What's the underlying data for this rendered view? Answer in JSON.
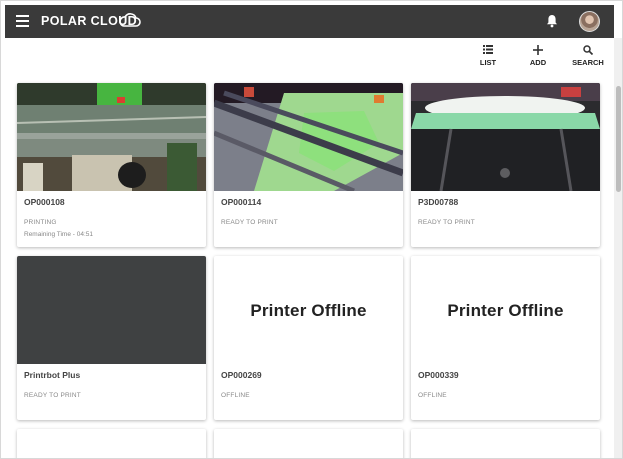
{
  "header": {
    "logo": "POLAR CLOUD",
    "menu_icon": "hamburger-menu-icon",
    "cloud_icon": "cloud-outline-icon",
    "bell_icon": "notification-bell-icon"
  },
  "toolbar": {
    "list_label": "LIST",
    "add_label": "ADD",
    "search_label": "SEARCH"
  },
  "printers": [
    {
      "name": "OP000108",
      "status": "PRINTING",
      "remaining": "Remaining Time - 04:51",
      "image": "camera-feed"
    },
    {
      "name": "OP000114",
      "status": "READY TO PRINT",
      "image": "camera-feed"
    },
    {
      "name": "P3D00788",
      "status": "READY TO PRINT",
      "image": "camera-feed"
    },
    {
      "name": "Printrbot Plus",
      "status": "READY TO PRINT",
      "image": "camera-feed"
    },
    {
      "name": "OP000269",
      "status": "OFFLINE",
      "offline_text": "Printer Offline"
    },
    {
      "name": "OP000339",
      "status": "OFFLINE",
      "offline_text": "Printer Offline"
    }
  ],
  "colors": {
    "topbar": "#3a3a3a",
    "card_text": "#444444",
    "status_text": "#888888"
  }
}
